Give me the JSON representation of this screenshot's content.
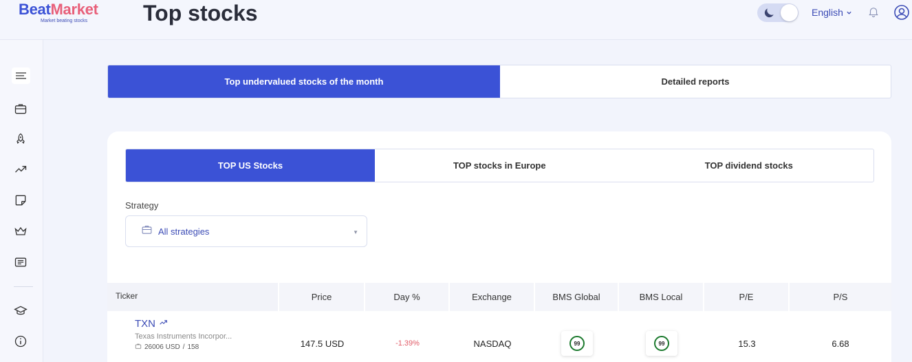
{
  "brand": {
    "name_part1": "Beat",
    "name_part2": "Market",
    "tagline": "Market beating stocks"
  },
  "header": {
    "title": "Top stocks",
    "language": "English",
    "colors": {
      "accent": "#3b52d6",
      "brand_pink": "#e8607a"
    }
  },
  "sidebar": {
    "icons": [
      "menu-icon",
      "briefcase-icon",
      "rocket-icon",
      "trending-up-icon",
      "sticky-note-icon",
      "crown-icon",
      "newspaper-icon",
      "graduation-cap-icon",
      "info-icon"
    ]
  },
  "top_tabs": [
    {
      "label": "Top undervalued stocks of the month",
      "active": true
    },
    {
      "label": "Detailed reports",
      "active": false
    }
  ],
  "sub_tabs": [
    {
      "label": "TOP US Stocks",
      "active": true
    },
    {
      "label": "TOP stocks in Europe",
      "active": false
    },
    {
      "label": "TOP dividend stocks",
      "active": false
    }
  ],
  "strategy": {
    "label": "Strategy",
    "value": "All strategies"
  },
  "table": {
    "headers": [
      "Ticker",
      "Price",
      "Day %",
      "Exchange",
      "BMS Global",
      "BMS Local",
      "P/E",
      "P/S"
    ],
    "rows": [
      {
        "symbol": "TXN",
        "name": "Texas Instruments Incorpor...",
        "market_cap": "26006 USD",
        "rank": "158",
        "price": "147.5 USD",
        "day_pct": "-1.39%",
        "exchange": "NASDAQ",
        "bms_global": "99",
        "bms_local": "99",
        "pe": "15.3",
        "ps": "6.68"
      }
    ]
  }
}
